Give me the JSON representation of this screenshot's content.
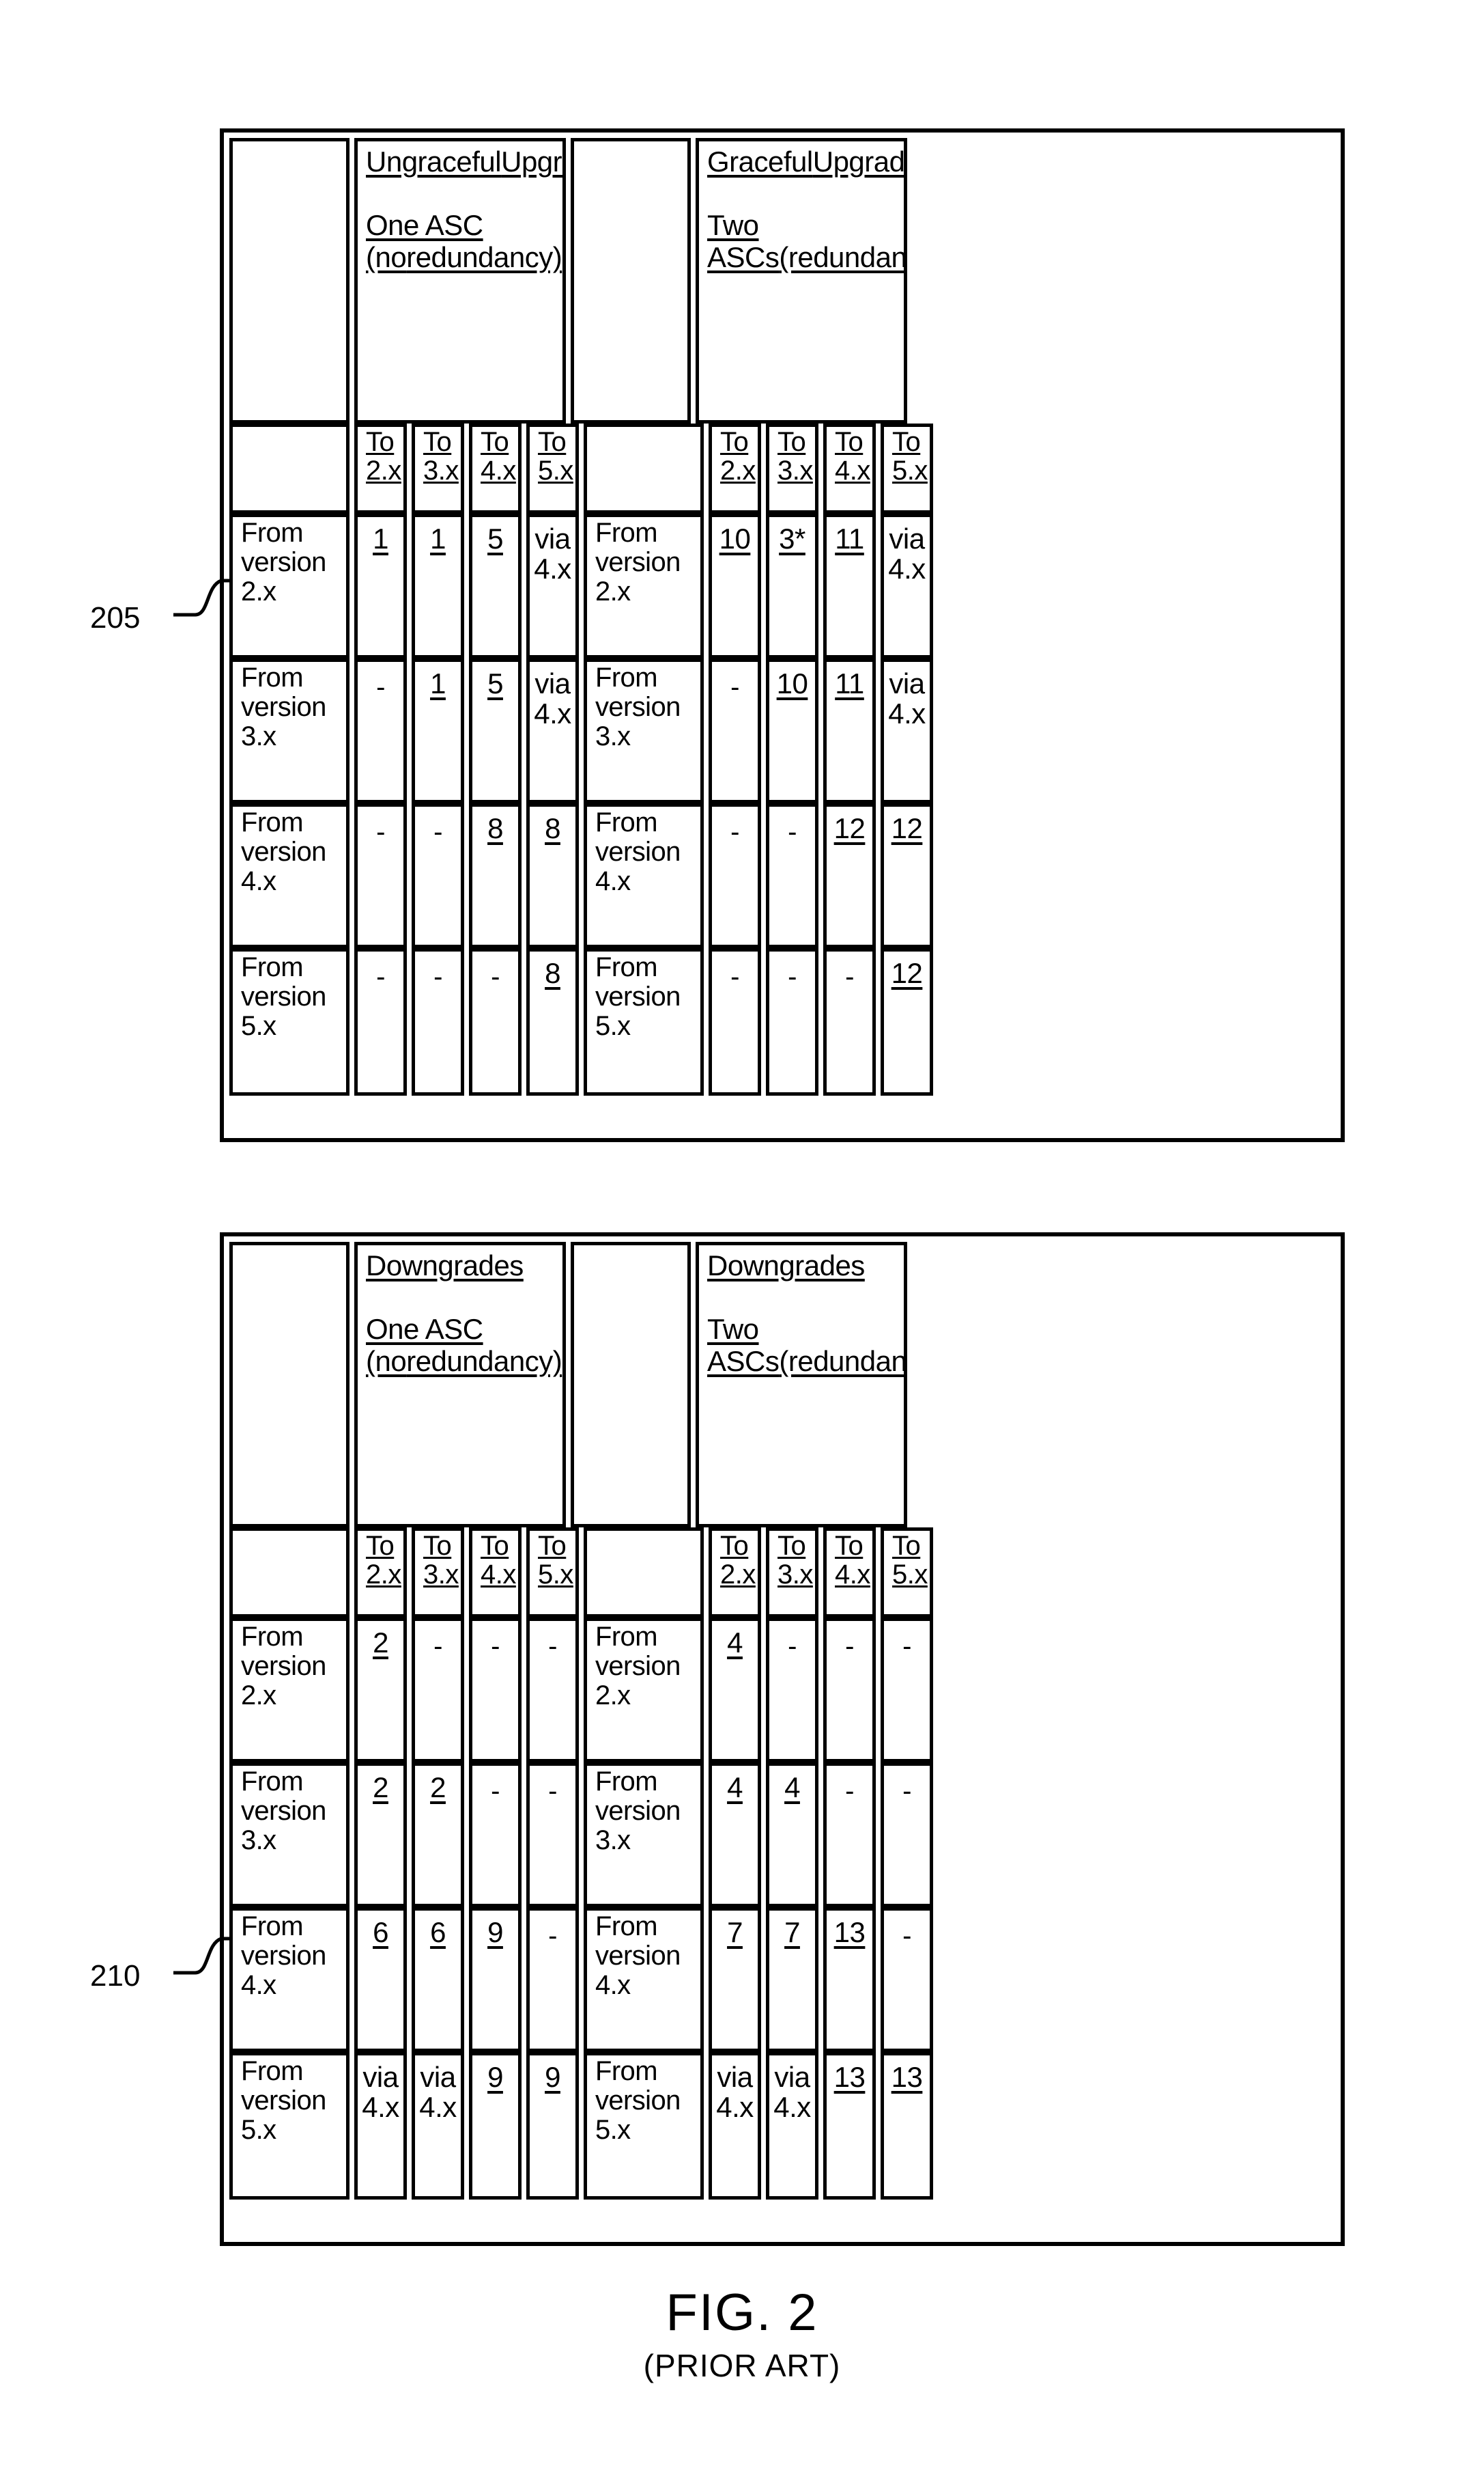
{
  "figure": {
    "number": "FIG. 2",
    "subtitle": "(PRIOR ART)"
  },
  "refs": {
    "upper_table": "205",
    "lower_table": "210"
  },
  "column_headers": {
    "blank": "",
    "to_2x": "To\n2.x",
    "to_3x": "To\n3.x",
    "to_4x": "To\n4.x",
    "to_5x": "To\n5.x"
  },
  "row_labels": {
    "from_2x": "From\nversion\n2.x",
    "from_3x": "From\nversion\n3.x",
    "from_4x": "From\nversion\n4.x",
    "from_5x": "From\nversion\n5.x"
  },
  "tables": [
    {
      "id": "upgrades",
      "ref": "205",
      "left_banner": {
        "line1": "Ungraceful",
        "line2": "Upgrades",
        "line3": "One ASC (no",
        "line4": "redundancy)",
        "has_gap": true
      },
      "right_banner": {
        "line1": "Graceful",
        "line2": "Upgrades",
        "line3": "Two ASCs",
        "line4": "(redundant)",
        "has_gap": true
      },
      "columns": [
        "To\n2.x",
        "To\n3.x",
        "To\n4.x",
        "To\n5.x"
      ],
      "rows": [
        {
          "label": "From\nversion\n2.x",
          "left_values": [
            {
              "text": "1",
              "underline": true
            },
            {
              "text": "1",
              "underline": true
            },
            {
              "text": "5",
              "underline": true
            },
            {
              "text": "via\n4.x",
              "underline": false
            }
          ],
          "right_values": [
            {
              "text": "10",
              "underline": true
            },
            {
              "text": "3*",
              "underline": true
            },
            {
              "text": "11",
              "underline": true
            },
            {
              "text": "via\n4.x",
              "underline": false
            }
          ]
        },
        {
          "label": "From\nversion\n3.x",
          "left_values": [
            {
              "text": "-",
              "underline": false
            },
            {
              "text": "1",
              "underline": true
            },
            {
              "text": "5",
              "underline": true
            },
            {
              "text": "via\n4.x",
              "underline": false
            }
          ],
          "right_values": [
            {
              "text": "-",
              "underline": false
            },
            {
              "text": "10",
              "underline": true
            },
            {
              "text": "11",
              "underline": true
            },
            {
              "text": "via\n4.x",
              "underline": false
            }
          ]
        },
        {
          "label": "From\nversion\n4.x",
          "left_values": [
            {
              "text": "-",
              "underline": false
            },
            {
              "text": "-",
              "underline": false
            },
            {
              "text": "8",
              "underline": true
            },
            {
              "text": "8",
              "underline": true
            }
          ],
          "right_values": [
            {
              "text": "-",
              "underline": false
            },
            {
              "text": "-",
              "underline": false
            },
            {
              "text": "12",
              "underline": true
            },
            {
              "text": "12",
              "underline": true
            }
          ]
        },
        {
          "label": "From\nversion\n5.x",
          "left_values": [
            {
              "text": "-",
              "underline": false
            },
            {
              "text": "-",
              "underline": false
            },
            {
              "text": "-",
              "underline": false
            },
            {
              "text": "8",
              "underline": true
            }
          ],
          "right_values": [
            {
              "text": "-",
              "underline": false
            },
            {
              "text": "-",
              "underline": false
            },
            {
              "text": "-",
              "underline": false
            },
            {
              "text": "12",
              "underline": true
            }
          ]
        }
      ]
    },
    {
      "id": "downgrades",
      "ref": "210",
      "left_banner": {
        "line1": "Downgrades",
        "line2": "",
        "line3": "One ASC (no",
        "line4": "redundancy)",
        "has_gap": true
      },
      "right_banner": {
        "line1": "Downgrades",
        "line2": "",
        "line3": "Two ASCs",
        "line4": "(redundant)",
        "has_gap": true
      },
      "columns": [
        "To\n2.x",
        "To\n3.x",
        "To\n4.x",
        "To\n5.x"
      ],
      "rows": [
        {
          "label": "From\nversion\n2.x",
          "left_values": [
            {
              "text": "2",
              "underline": true
            },
            {
              "text": "-",
              "underline": false
            },
            {
              "text": "-",
              "underline": false
            },
            {
              "text": "-",
              "underline": false
            }
          ],
          "right_values": [
            {
              "text": "4",
              "underline": true
            },
            {
              "text": "-",
              "underline": false
            },
            {
              "text": "-",
              "underline": false
            },
            {
              "text": "-",
              "underline": false
            }
          ]
        },
        {
          "label": "From\nversion\n3.x",
          "left_values": [
            {
              "text": "2",
              "underline": true
            },
            {
              "text": "2",
              "underline": true
            },
            {
              "text": "-",
              "underline": false
            },
            {
              "text": "-",
              "underline": false
            }
          ],
          "right_values": [
            {
              "text": "4",
              "underline": true
            },
            {
              "text": "4",
              "underline": true
            },
            {
              "text": "-",
              "underline": false
            },
            {
              "text": "-",
              "underline": false
            }
          ]
        },
        {
          "label": "From\nversion\n4.x",
          "left_values": [
            {
              "text": "6",
              "underline": true
            },
            {
              "text": "6",
              "underline": true
            },
            {
              "text": "9",
              "underline": true
            },
            {
              "text": "-",
              "underline": false
            }
          ],
          "right_values": [
            {
              "text": "7",
              "underline": true
            },
            {
              "text": "7",
              "underline": true
            },
            {
              "text": "13",
              "underline": true
            },
            {
              "text": "-",
              "underline": false
            }
          ]
        },
        {
          "label": "From\nversion\n5.x",
          "left_values": [
            {
              "text": "via\n4.x",
              "underline": false
            },
            {
              "text": "via\n4.x",
              "underline": false
            },
            {
              "text": "9",
              "underline": true
            },
            {
              "text": "9",
              "underline": true
            }
          ],
          "right_values": [
            {
              "text": "via\n4.x",
              "underline": false
            },
            {
              "text": "via\n4.x",
              "underline": false
            },
            {
              "text": "13",
              "underline": true
            },
            {
              "text": "13",
              "underline": true
            }
          ]
        }
      ]
    }
  ]
}
